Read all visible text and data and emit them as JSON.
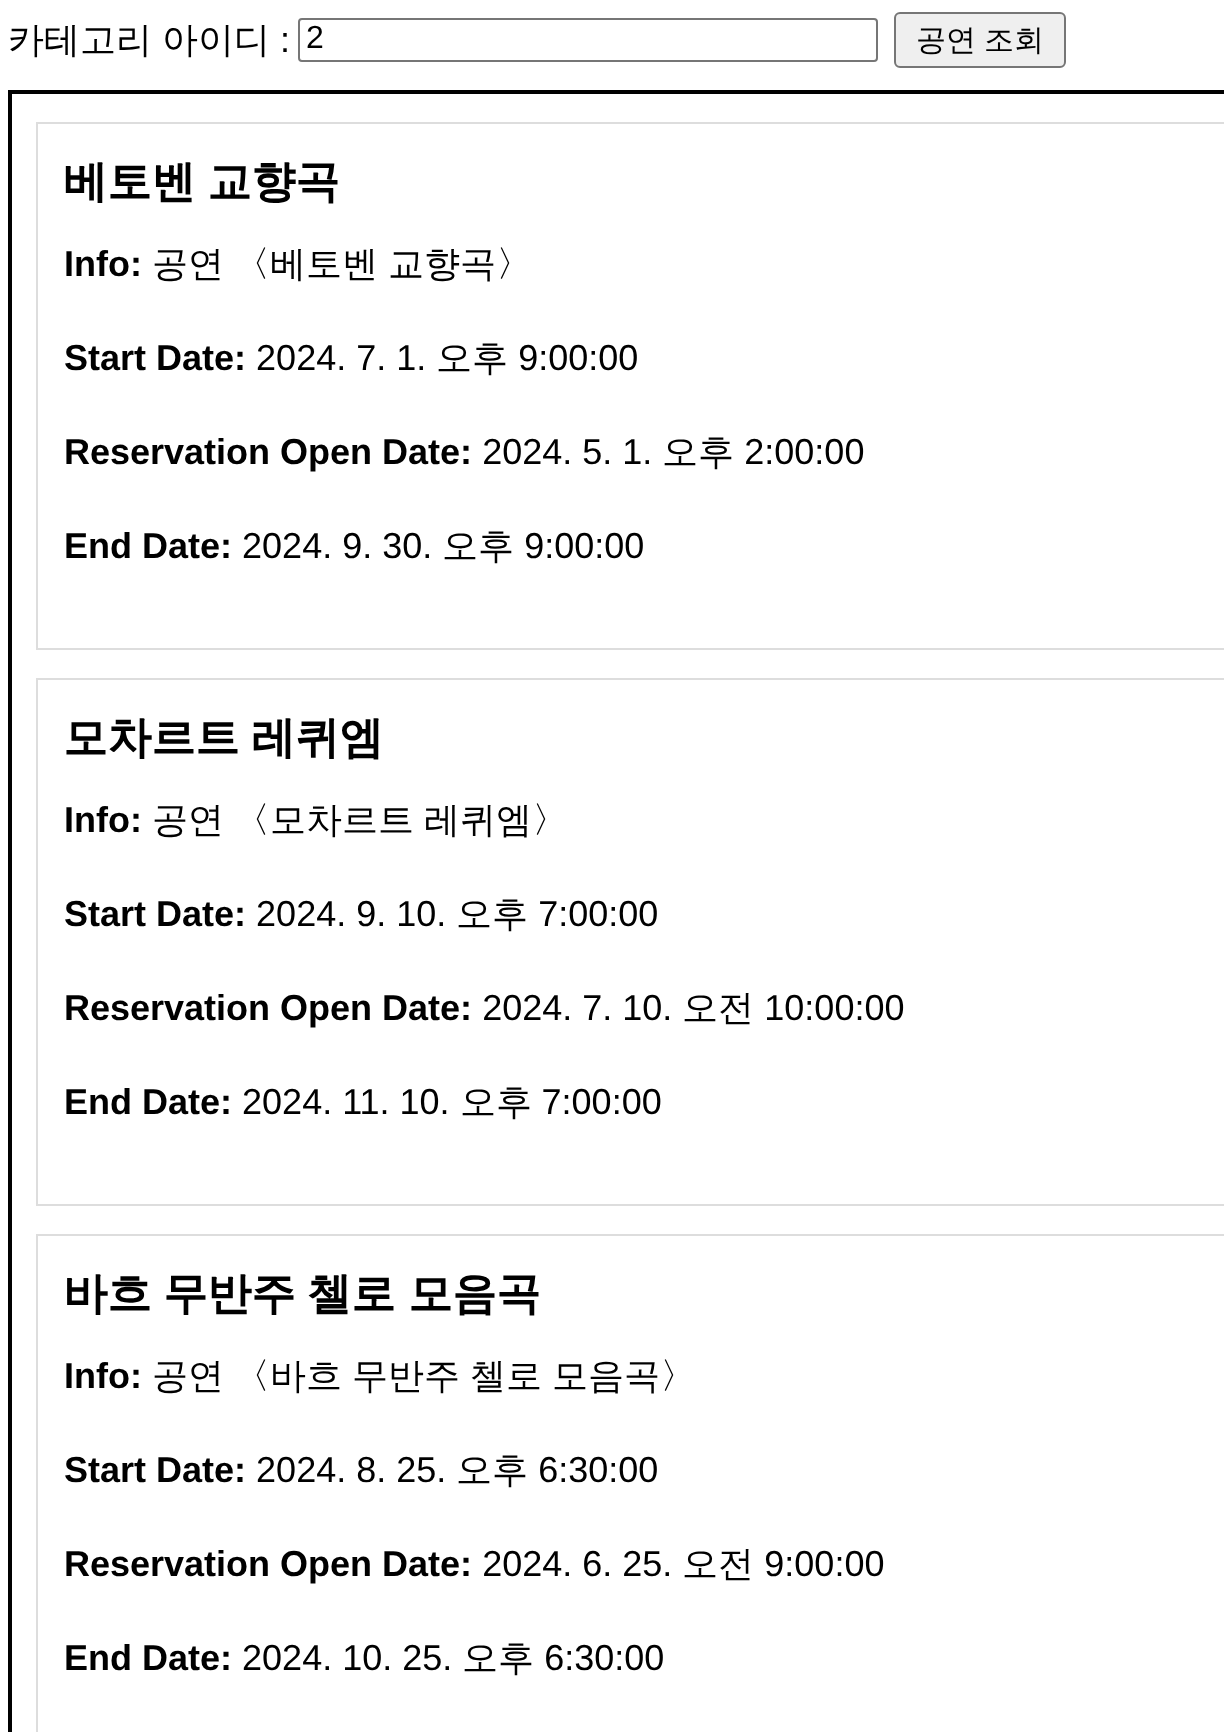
{
  "search": {
    "label": "카테고리 아이디 :",
    "value": "2",
    "button": "공연 조회"
  },
  "performances": [
    {
      "title": "베토벤 교향곡",
      "fields": [
        {
          "label": "Info:",
          "value": "공연 〈베토벤 교향곡〉"
        },
        {
          "label": "Start Date:",
          "value": "2024. 7. 1. 오후 9:00:00"
        },
        {
          "label": "Reservation Open Date:",
          "value": "2024. 5. 1. 오후 2:00:00"
        },
        {
          "label": "End Date:",
          "value": "2024. 9. 30. 오후 9:00:00"
        }
      ]
    },
    {
      "title": "모차르트 레퀴엠",
      "fields": [
        {
          "label": "Info:",
          "value": "공연 〈모차르트 레퀴엠〉"
        },
        {
          "label": "Start Date:",
          "value": "2024. 9. 10. 오후 7:00:00"
        },
        {
          "label": "Reservation Open Date:",
          "value": "2024. 7. 10. 오전 10:00:00"
        },
        {
          "label": "End Date:",
          "value": "2024. 11. 10. 오후 7:00:00"
        }
      ]
    },
    {
      "title": "바흐 무반주 첼로 모음곡",
      "fields": [
        {
          "label": "Info:",
          "value": "공연 〈바흐 무반주 첼로 모음곡〉"
        },
        {
          "label": "Start Date:",
          "value": "2024. 8. 25. 오후 6:30:00"
        },
        {
          "label": "Reservation Open Date:",
          "value": "2024. 6. 25. 오전 9:00:00"
        },
        {
          "label": "End Date:",
          "value": "2024. 10. 25. 오후 6:30:00"
        }
      ]
    }
  ]
}
